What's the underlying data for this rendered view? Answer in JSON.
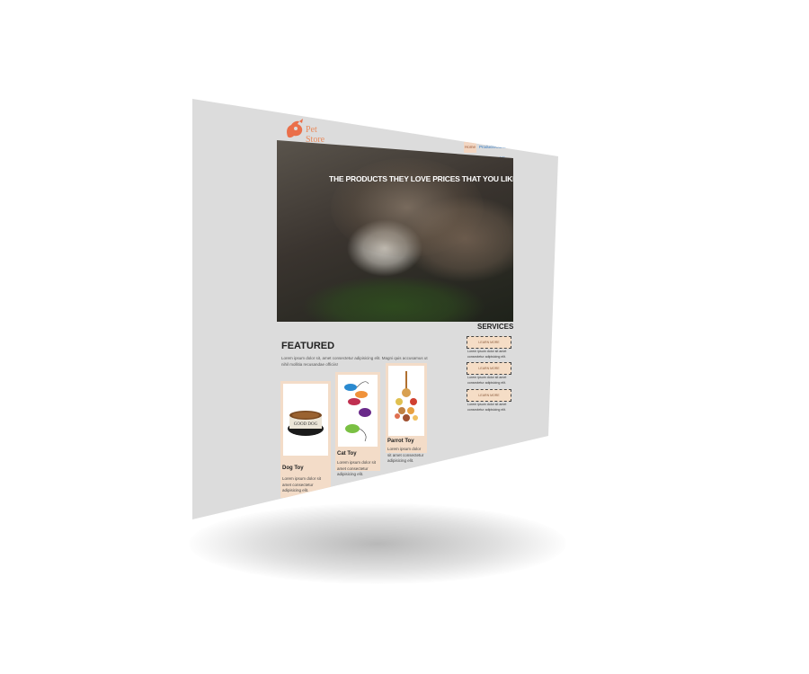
{
  "logo": {
    "text": "Pet Store",
    "color": "#e98b5d"
  },
  "nav": {
    "items": [
      "Home",
      "Products",
      "Contact Us"
    ]
  },
  "hero": {
    "title": "THE PRODUCTS THEY LOVE PRICES THAT YOU LIKE"
  },
  "featured": {
    "title": "FEATURED",
    "description": "Lorem ipsum dolor sit, amet consectetur adipisicing elit. Magni quis accusamus ut nihil mollitia recusandae officiis!",
    "products": [
      {
        "name": "Dog Toy",
        "image_label": "GOOD DOG",
        "description": "Lorem ipsum dolor sit amet consectetur adipisicing elit."
      },
      {
        "name": "Cat Toy",
        "description": "Lorem ipsum dolor sit amet consectetur adipisicing elit."
      },
      {
        "name": "Parrot Toy",
        "description": "Lorem ipsum dolor sit amet consectetur adipisicing elit."
      }
    ]
  },
  "services": {
    "title": "SERVICES",
    "items": [
      {
        "label": "LEARN MORE",
        "description": "Lorem ipsum dolor sit amet consectetur adipisicing elit."
      },
      {
        "label": "LEARN MORE",
        "description": "Lorem ipsum dolor sit amet consectetur adipisicing elit."
      },
      {
        "label": "LEARN MORE",
        "description": "Lorem ipsum dolor sit amet consectetur adipisicing elit."
      }
    ]
  },
  "colors": {
    "page_bg": "#dcdcdc",
    "accent": "#f3dcc8",
    "link": "#2f78c4"
  }
}
